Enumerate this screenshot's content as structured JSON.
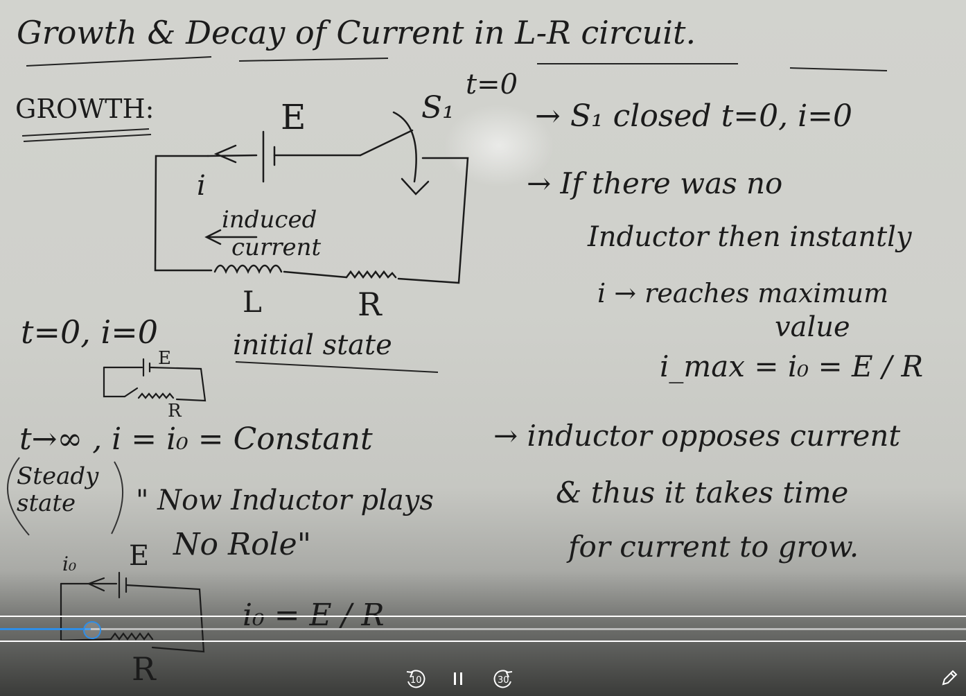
{
  "board": {
    "title": "Growth & Decay of Current in L-R circuit.",
    "growth_heading": "GROWTH:",
    "circuit_labels": {
      "emf": "E",
      "switch": "S₁",
      "switch_time": "t=0",
      "current": "i",
      "induced_1": "induced",
      "induced_2": "current",
      "inductor": "L",
      "resistor": "R"
    },
    "notes_right": [
      "→ S₁ closed  t=0, i=0",
      "→ If there was no",
      "Inductor then instantly",
      "i → reaches maximum",
      "value",
      "i_max = i₀ = E / R",
      "→ inductor opposes current",
      "& thus it takes time",
      "for current to grow."
    ],
    "left_notes": {
      "initial_eq": "t=0, i=0",
      "initial_state": "initial state",
      "small_e": "E",
      "small_r": "R",
      "steady_eq": "t→∞ , i = i₀ = Constant",
      "steady_paren": "Steady state",
      "no_role_1": "\" Now Inductor plays",
      "no_role_2": "No Role\"",
      "bottom_io": "i₀",
      "bottom_e": "E",
      "bottom_r": "R",
      "bottom_eq": "i₀ = E / R"
    }
  },
  "player": {
    "progress_fraction": 0.094,
    "rewind_label": "10",
    "forward_label": "30",
    "accent": "#2f8ee6"
  }
}
